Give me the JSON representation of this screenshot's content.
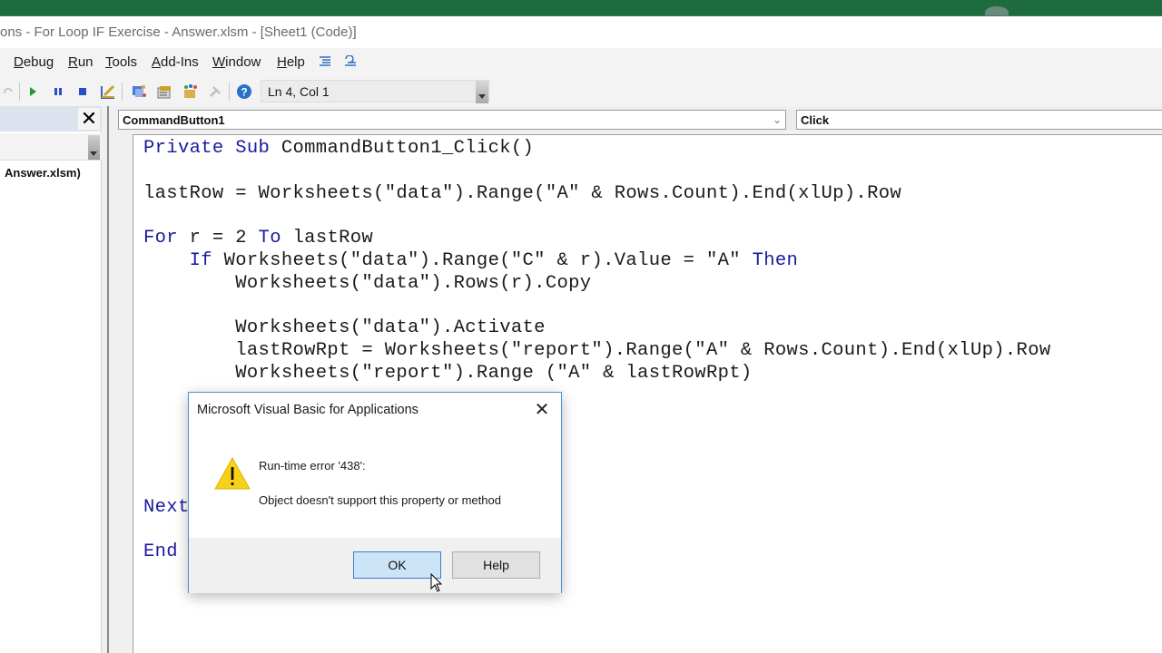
{
  "window": {
    "title": "ons - For Loop IF Exercise - Answer.xlsm - [Sheet1 (Code)]"
  },
  "menu": {
    "items": [
      {
        "label": "Debug",
        "accel": "D"
      },
      {
        "label": "Run",
        "accel": "R"
      },
      {
        "label": "Tools",
        "accel": "T"
      },
      {
        "label": "Add-Ins",
        "accel": "A"
      },
      {
        "label": "Window",
        "accel": "W"
      },
      {
        "label": "Help",
        "accel": "H"
      }
    ],
    "icons": [
      "indent-icon",
      "outdent-icon"
    ]
  },
  "toolbar": {
    "buttons": [
      "redo-icon",
      "run-icon",
      "break-icon",
      "reset-icon",
      "design-mode-icon",
      "project-explorer-icon",
      "properties-window-icon",
      "object-browser-icon",
      "toolbox-icon",
      "help-icon"
    ],
    "position_status": "Ln 4, Col 1"
  },
  "project_panel": {
    "close_label": "✕",
    "tree_item": "Answer.xlsm)"
  },
  "code_window": {
    "object_combo": "CommandButton1",
    "procedure_combo": "Click",
    "lines": [
      {
        "indent": "",
        "tokens": [
          {
            "t": "Private Sub",
            "kw": true
          },
          {
            "t": " CommandButton1_Click()",
            "kw": false
          }
        ]
      },
      {
        "indent": "",
        "tokens": [
          {
            "t": "lastRow = Worksheets(\"data\").Range(\"A\" & Rows.Count).End(xlUp).Row",
            "kw": false
          }
        ]
      },
      {
        "indent": "",
        "tokens": [
          {
            "t": "For",
            "kw": true
          },
          {
            "t": " r = 2 ",
            "kw": false
          },
          {
            "t": "To",
            "kw": true
          },
          {
            "t": " lastRow",
            "kw": false
          }
        ]
      },
      {
        "indent": "    ",
        "tokens": [
          {
            "t": "If",
            "kw": true
          },
          {
            "t": " Worksheets(\"data\").Range(\"C\" & r).Value = \"A\" ",
            "kw": false
          },
          {
            "t": "Then",
            "kw": true
          }
        ]
      },
      {
        "indent": "        ",
        "tokens": [
          {
            "t": "Worksheets(\"data\").Rows(r).Copy",
            "kw": false
          }
        ]
      },
      {
        "indent": "        ",
        "tokens": [
          {
            "t": "Worksheets(\"data\").Activate",
            "kw": false
          }
        ]
      },
      {
        "indent": "        ",
        "tokens": [
          {
            "t": "lastRowRpt = Worksheets(\"report\").Range(\"A\" & Rows.Count).End(xlUp).Row",
            "kw": false
          }
        ]
      },
      {
        "indent": "        ",
        "tokens": [
          {
            "t": "Worksheets(\"report\").Range (\"A\" & lastRowRpt)",
            "kw": false
          }
        ]
      },
      {
        "indent": "",
        "tokens": [
          {
            "t": "Next",
            "kw": true
          }
        ]
      },
      {
        "indent": "",
        "tokens": [
          {
            "t": "End",
            "kw": true
          }
        ]
      }
    ]
  },
  "dialog": {
    "title": "Microsoft Visual Basic for Applications",
    "close_label": "✕",
    "error_line": "Run-time error '438':",
    "message": "Object doesn't support this property or method",
    "ok_label": "OK",
    "help_label": "Help",
    "icon": "warning-icon"
  },
  "colors": {
    "excel_green": "#1e6b3f",
    "keyword_blue": "#1a1a9e",
    "dialog_border": "#4a8fd8",
    "ok_button_bg": "#cce4f7"
  }
}
